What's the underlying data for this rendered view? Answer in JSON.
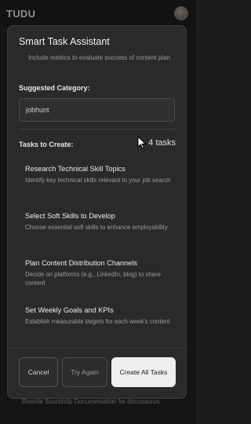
{
  "app": {
    "title": "TUDU"
  },
  "background": {
    "task_text": "Rewrite Soundslip Documentation for docusaurus"
  },
  "modal": {
    "title": "Smart Task Assistant",
    "previous_text": "Include metrics to evaluate success of content plan",
    "category_label": "Suggested Category:",
    "category_value": "jobhunt",
    "tasks_label": "Tasks to Create:",
    "tasks_count": "4 tasks",
    "tasks": [
      {
        "title": "Research Technical Skill Topics",
        "description": "Identify key technical skills relevant to your job search"
      },
      {
        "title": "Select Soft Skills to Develop",
        "description": "Choose essential soft skills to enhance employability"
      },
      {
        "title": "Plan Content Distribution Channels",
        "description": "Decide on platforms (e.g., LinkedIn, blog) to share content"
      },
      {
        "title": "Set Weekly Goals and KPIs",
        "description": "Establish measurable targets for each week's content"
      }
    ],
    "buttons": {
      "cancel": "Cancel",
      "retry": "Try Again",
      "create": "Create All Tasks"
    }
  },
  "colors": {
    "background": "#1c1c1c",
    "modal": "#2a2a2a",
    "primary_button": "#efefef"
  },
  "icons": {
    "avatar": "user-avatar",
    "cursor": "mouse-pointer-icon"
  }
}
